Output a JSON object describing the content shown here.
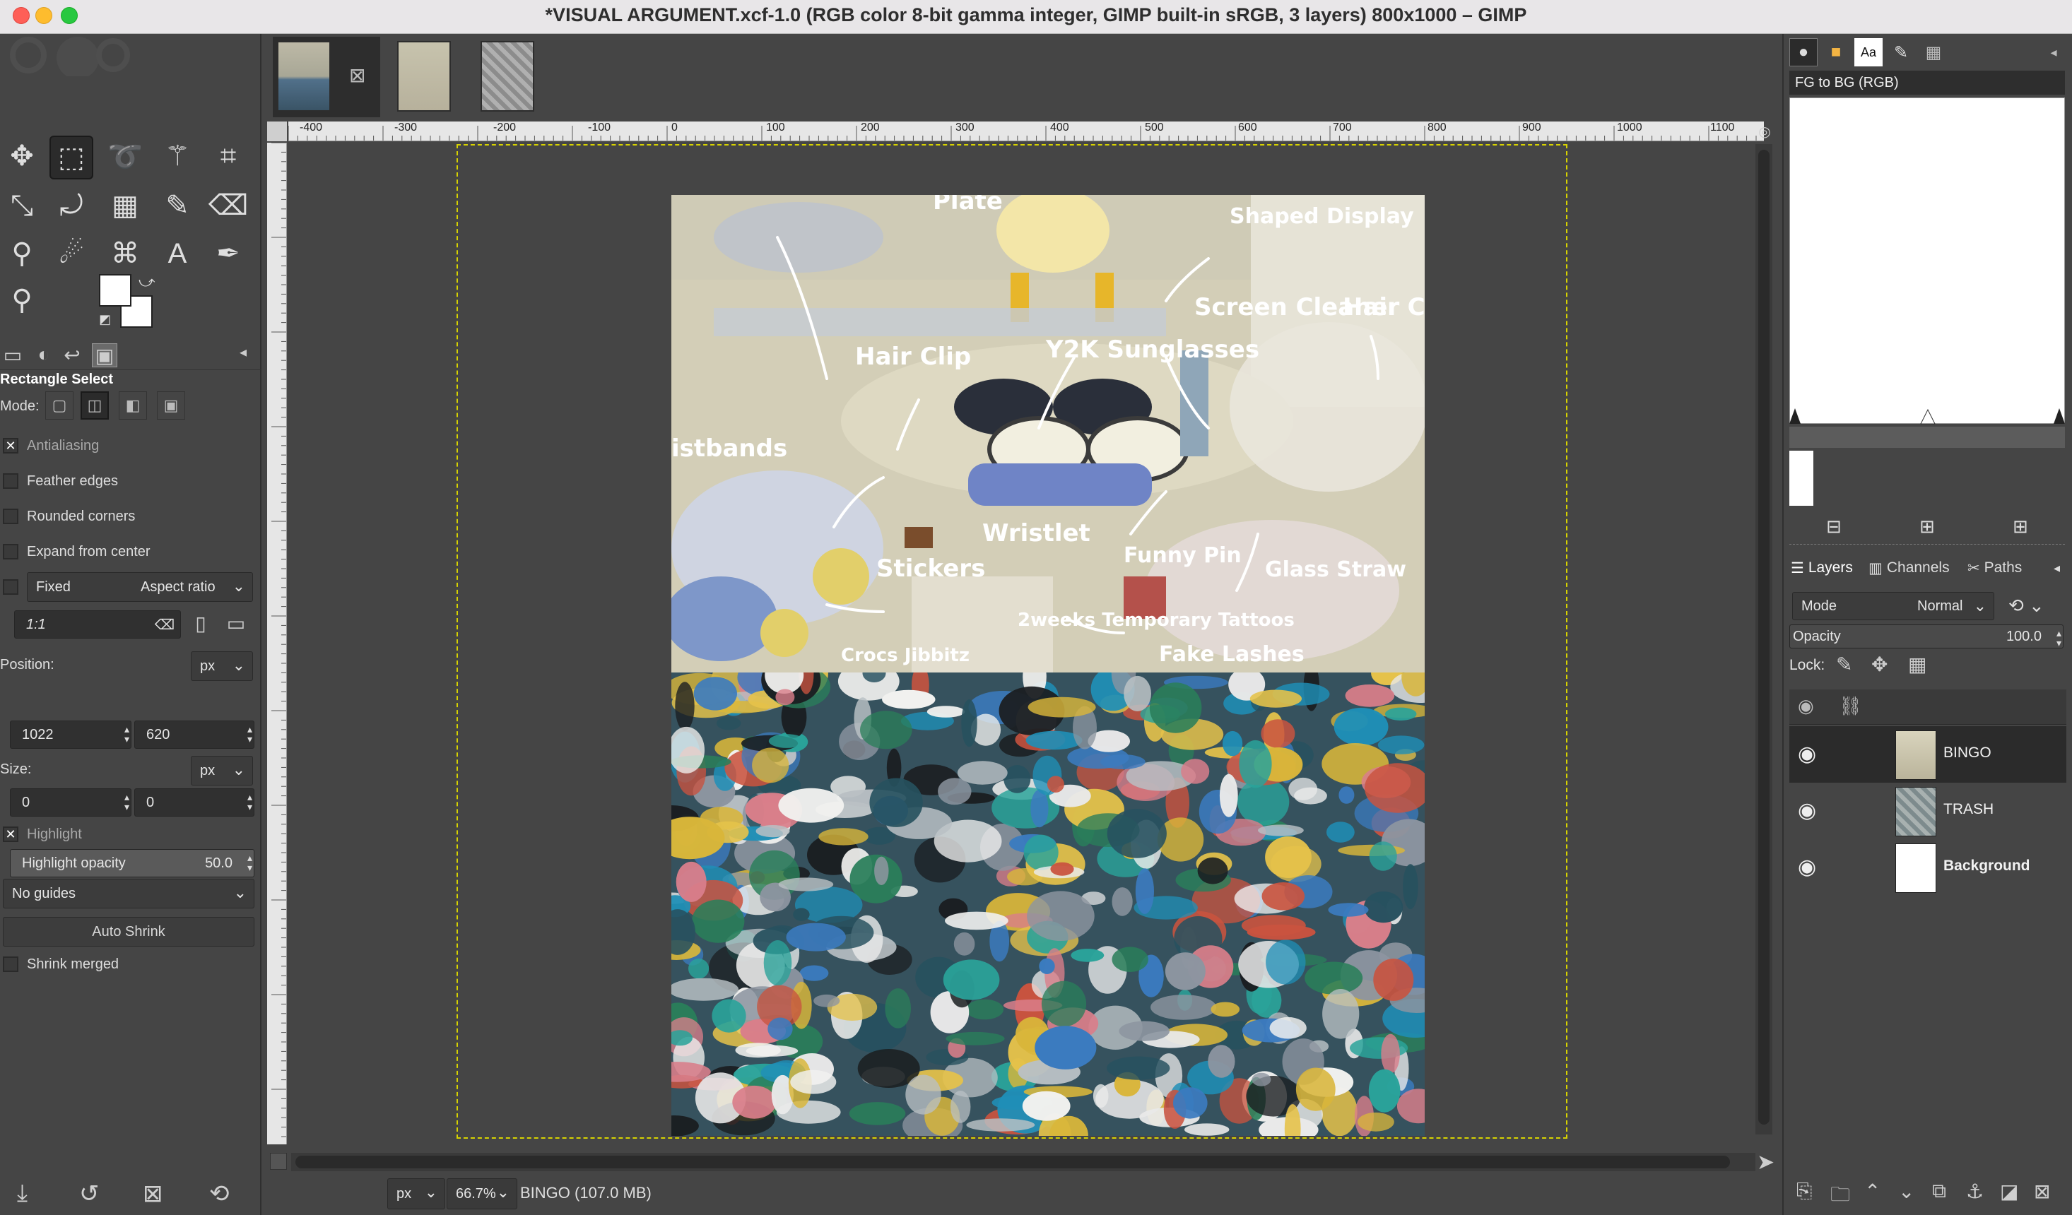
{
  "window": {
    "title": "*VISUAL ARGUMENT.xcf-1.0 (RGB color 8-bit gamma integer, GIMP built-in sRGB, 3 layers) 800x1000 – GIMP"
  },
  "tool_options": {
    "tool_name": "Rectangle Select",
    "mode_label": "Mode:",
    "antialiasing": "Antialiasing",
    "feather_edges": "Feather edges",
    "rounded_corners": "Rounded corners",
    "expand_from_center": "Expand from center",
    "fixed_label": "Fixed",
    "fixed_value": "Aspect ratio",
    "ratio_value": "1:1",
    "position_label": "Position:",
    "position_unit": "px",
    "position_x": "1022",
    "position_y": "620",
    "size_label": "Size:",
    "size_unit": "px",
    "size_w": "0",
    "size_h": "0",
    "highlight": "Highlight",
    "highlight_opacity_label": "Highlight opacity",
    "highlight_opacity_value": "50.0",
    "guides": "No guides",
    "auto_shrink": "Auto Shrink",
    "shrink_merged": "Shrink merged"
  },
  "ruler": {
    "h_labels": [
      "-400",
      "-300",
      "-200",
      "-100",
      "0",
      "100",
      "200",
      "300",
      "400",
      "500",
      "600",
      "700",
      "800",
      "900",
      "1000",
      "1100"
    ]
  },
  "statusbar": {
    "unit": "px",
    "zoom": "66.7%",
    "info": "BINGO (107.0 MB)"
  },
  "gradients": {
    "name": "FG to BG (RGB)"
  },
  "layers_panel": {
    "tabs": [
      "Layers",
      "Channels",
      "Paths"
    ],
    "mode_label": "Mode",
    "mode_value": "Normal",
    "opacity_label": "Opacity",
    "opacity_value": "100.0",
    "lock_label": "Lock:",
    "layers": [
      {
        "name": "BINGO"
      },
      {
        "name": "TRASH"
      },
      {
        "name": "Background"
      }
    ]
  },
  "canvas": {
    "annotations": [
      "Plate",
      "Shaped Display",
      "Screen Cleaner",
      "Hair Clip",
      "Y2K Sunglasses",
      "Hair Clip",
      "istbands",
      "Stickers",
      "Wristlet",
      "Funny Pin",
      "Glass Straw",
      "2weeks Temporary Tattoos",
      "Crocs Jibbitz",
      "Fake Lashes"
    ]
  }
}
